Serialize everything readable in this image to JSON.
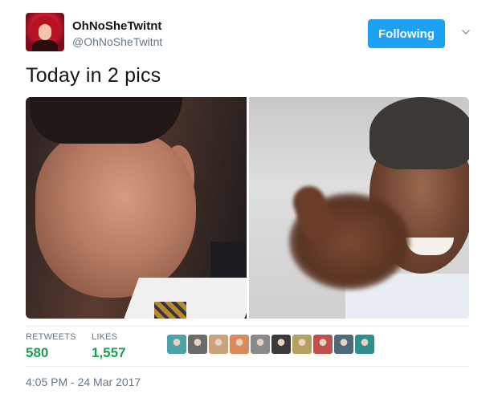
{
  "author": {
    "display_name": "OhNoSheTwitnt",
    "handle": "@OhNoSheTwitnt",
    "avatar_icon": "profile-avatar"
  },
  "follow_button": {
    "label": "Following",
    "color": "#1da1f2"
  },
  "menu_icon": "chevron-down-icon",
  "tweet": {
    "text": "Today in 2 pics",
    "media": [
      {
        "name": "photo-left"
      },
      {
        "name": "photo-right"
      }
    ]
  },
  "stats": {
    "retweets_label": "RETWEETS",
    "retweets_value": "580",
    "likes_label": "LIKES",
    "likes_value": "1,557",
    "value_color": "#1d9e52"
  },
  "likers": [
    {
      "color": "#4aa3a8"
    },
    {
      "color": "#6b6b6b"
    },
    {
      "color": "#c9a27a"
    },
    {
      "color": "#d88a5a"
    },
    {
      "color": "#8a8a8a"
    },
    {
      "color": "#3a3a3a"
    },
    {
      "color": "#b5a060"
    },
    {
      "color": "#c0504d"
    },
    {
      "color": "#4d6b7a"
    },
    {
      "color": "#2f8f8a"
    }
  ],
  "timestamp": "4:05 PM - 24 Mar 2017"
}
